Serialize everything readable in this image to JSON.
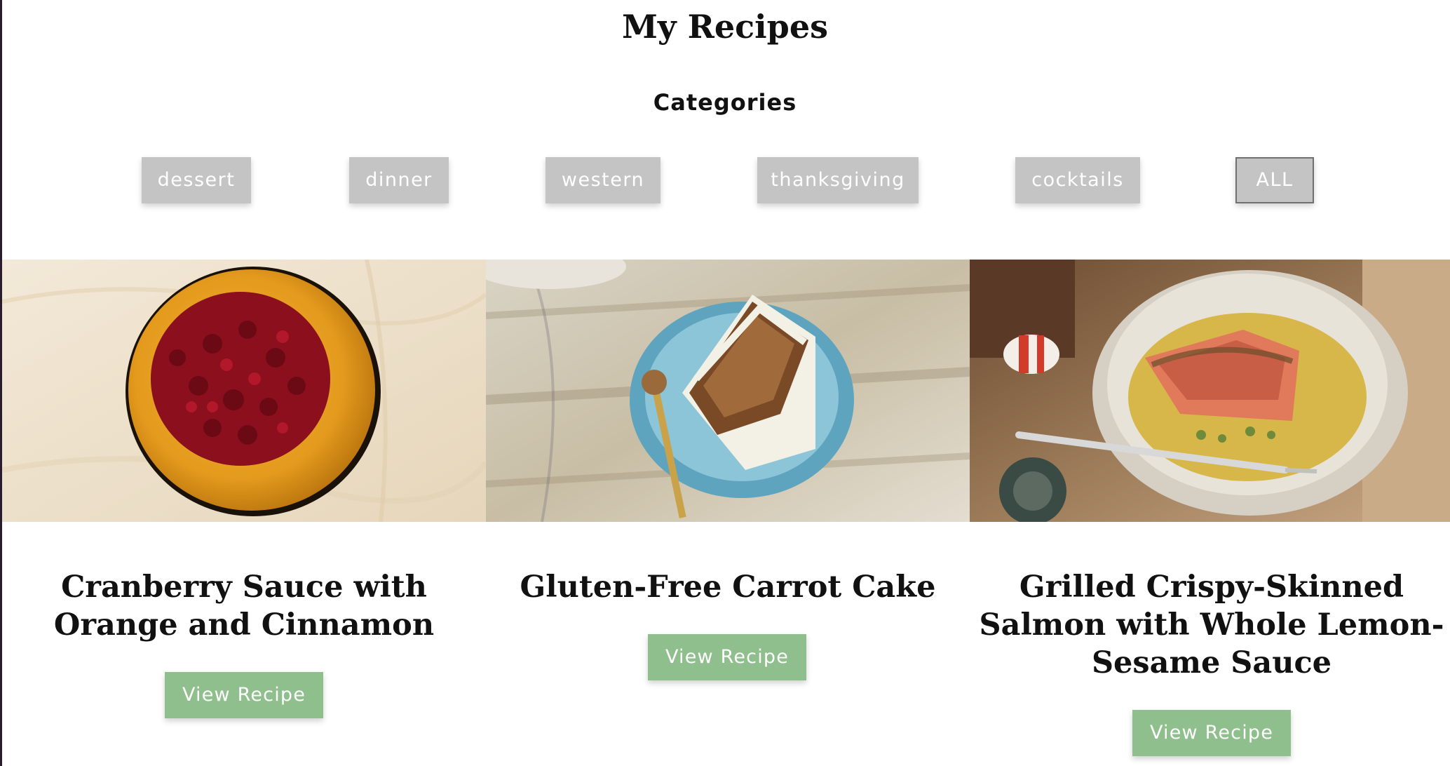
{
  "header": {
    "title": "My Recipes",
    "categories_heading": "Categories"
  },
  "categories": [
    {
      "label": "dessert",
      "active": false
    },
    {
      "label": "dinner",
      "active": false
    },
    {
      "label": "western",
      "active": false
    },
    {
      "label": "thanksgiving",
      "active": false
    },
    {
      "label": "cocktails",
      "active": false
    },
    {
      "label": "ALL",
      "active": true
    }
  ],
  "recipes": [
    {
      "title": "Cranberry Sauce with Orange and Cinnamon",
      "button_label": "View Recipe",
      "image": "cranberry-sauce-photo"
    },
    {
      "title": "Gluten-Free Carrot Cake",
      "button_label": "View Recipe",
      "image": "carrot-cake-photo"
    },
    {
      "title": "Grilled Crispy-Skinned Salmon with Whole Lemon-Sesame Sauce",
      "button_label": "View Recipe",
      "image": "salmon-photo"
    }
  ],
  "colors": {
    "category_button_bg": "#c4c4c4",
    "view_button_bg": "#8fbf8c",
    "text": "#111111"
  }
}
